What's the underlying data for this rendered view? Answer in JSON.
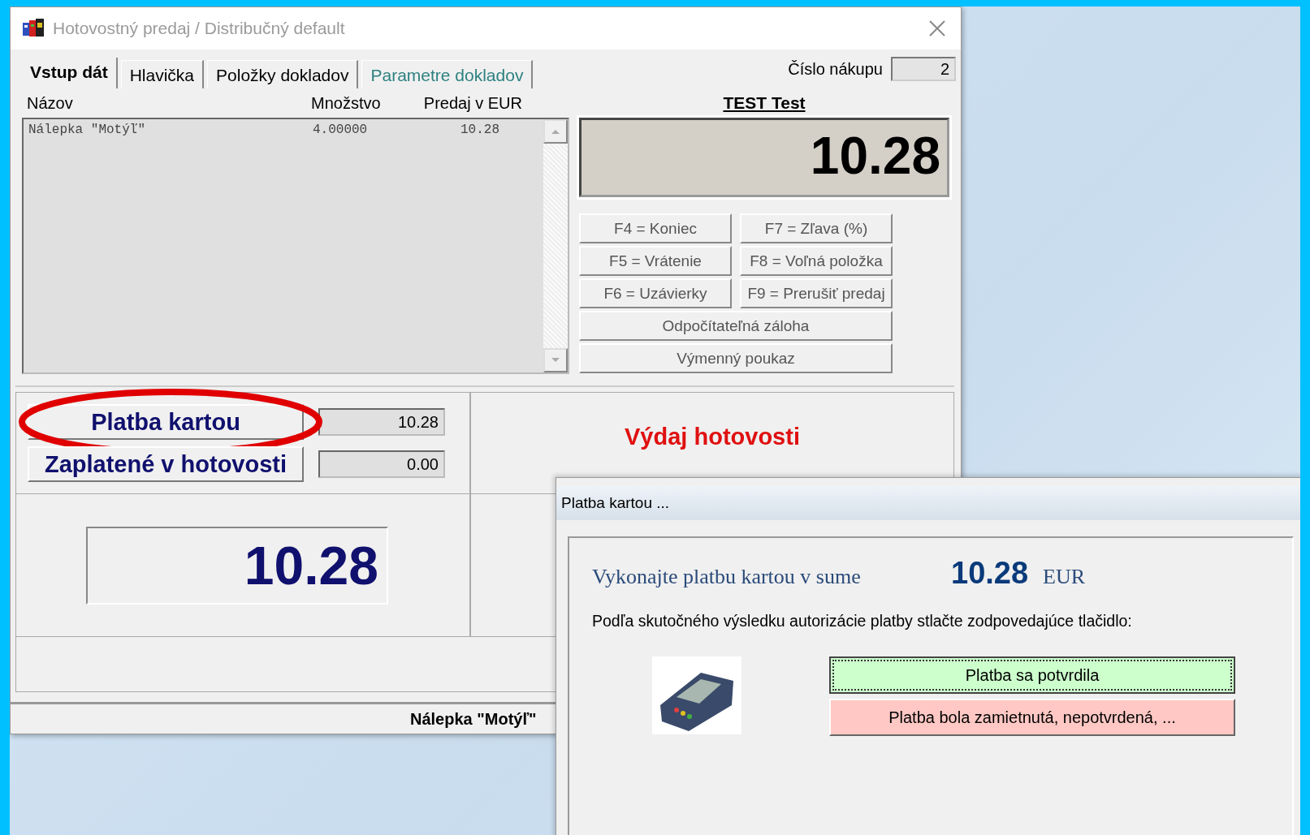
{
  "window": {
    "title": "Hotovostný predaj / Distribučný default"
  },
  "tabs": [
    {
      "label": "Vstup dát",
      "selected": true,
      "color": "#000000"
    },
    {
      "label": "Hlavička",
      "selected": false,
      "color": "#000000"
    },
    {
      "label": "Položky dokladov",
      "selected": false,
      "color": "#000000"
    },
    {
      "label": "Parametre dokladov",
      "selected": false,
      "color": "#2e8080"
    }
  ],
  "purchase_number": {
    "label": "Číslo nákupu",
    "value": "2"
  },
  "items_table": {
    "columns": [
      "Názov",
      "Množstvo",
      "Predaj v EUR"
    ],
    "rows": [
      {
        "name": "Nálepka \"Motýľ\"",
        "quantity": "4.00000",
        "price": "10.28"
      }
    ]
  },
  "customer": "TEST Test",
  "total_display": "10.28",
  "function_buttons": [
    {
      "label": "F4 = Koniec",
      "kind": "half"
    },
    {
      "label": "F7 = Zľava (%)",
      "kind": "half"
    },
    {
      "label": "F5 = Vrátenie",
      "kind": "half"
    },
    {
      "label": "F8 = Voľná položka",
      "kind": "half"
    },
    {
      "label": "F6 = Uzávierky",
      "kind": "half"
    },
    {
      "label": "F9 = Prerušiť predaj",
      "kind": "half"
    },
    {
      "label": "Odpočítateľná záloha",
      "kind": "full"
    },
    {
      "label": "Výmenný poukaz",
      "kind": "full"
    }
  ],
  "payments": [
    {
      "label": "Platba kartou",
      "value": "10.28",
      "circled": true
    },
    {
      "label": "Zaplatené v hotovosti",
      "value": "0.00",
      "circled": false
    }
  ],
  "cash_out_label": "Výdaj hotovosti",
  "big_total": "10.28",
  "status_bar": "Nálepka \"Motýľ\"",
  "dialog": {
    "title": "Platba kartou ...",
    "prompt": "Vykonajte platbu kartou v sume",
    "amount": "10.28",
    "currency": "EUR",
    "instruction": "Podľa skutočného výsledku autorizácie platby stlačte zodpovedajúce tlačidlo:",
    "buttons": [
      {
        "label": "Platba sa potvrdila",
        "kind": "confirm",
        "focused": true
      },
      {
        "label": "Platba bola zamietnutá, nepotvrdená, ...",
        "kind": "reject",
        "focused": false
      }
    ]
  }
}
